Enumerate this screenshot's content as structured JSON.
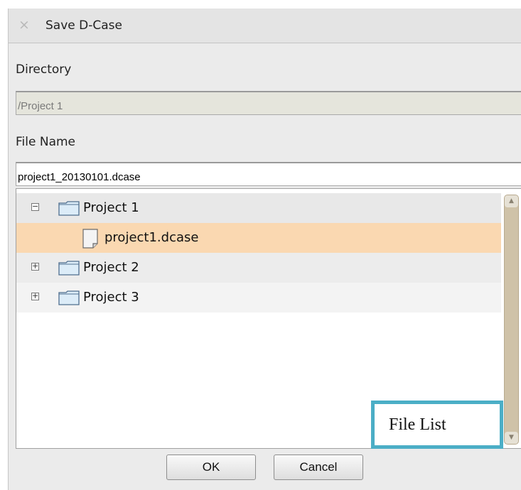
{
  "window": {
    "title": "Save D-Case",
    "close_glyph": "×"
  },
  "form": {
    "directory_label": "Directory",
    "directory_value": "/Project 1",
    "filename_label": "File Name",
    "filename_value": "project1_20130101.dcase"
  },
  "tree": {
    "items": [
      {
        "label": "Project 1",
        "type": "folder",
        "toggle": "−",
        "icon": "folder-icon"
      },
      {
        "label": "project1.dcase",
        "type": "file",
        "icon": "document-icon",
        "selected": true
      },
      {
        "label": "Project 2",
        "type": "folder",
        "toggle": "+",
        "icon": "folder-icon"
      },
      {
        "label": "Project 3",
        "type": "folder",
        "toggle": "+",
        "icon": "folder-icon"
      }
    ],
    "scroll_up_glyph": "▲",
    "scroll_down_glyph": "▼"
  },
  "callout": {
    "text": "File List",
    "color": "#4baec6"
  },
  "buttons": {
    "ok": "OK",
    "cancel": "Cancel"
  },
  "colors": {
    "selected_row": "#fad8b1",
    "folder_fill": "#dcecf8",
    "folder_stroke": "#4f6f8f",
    "scroll_track": "#cfc2a8"
  }
}
